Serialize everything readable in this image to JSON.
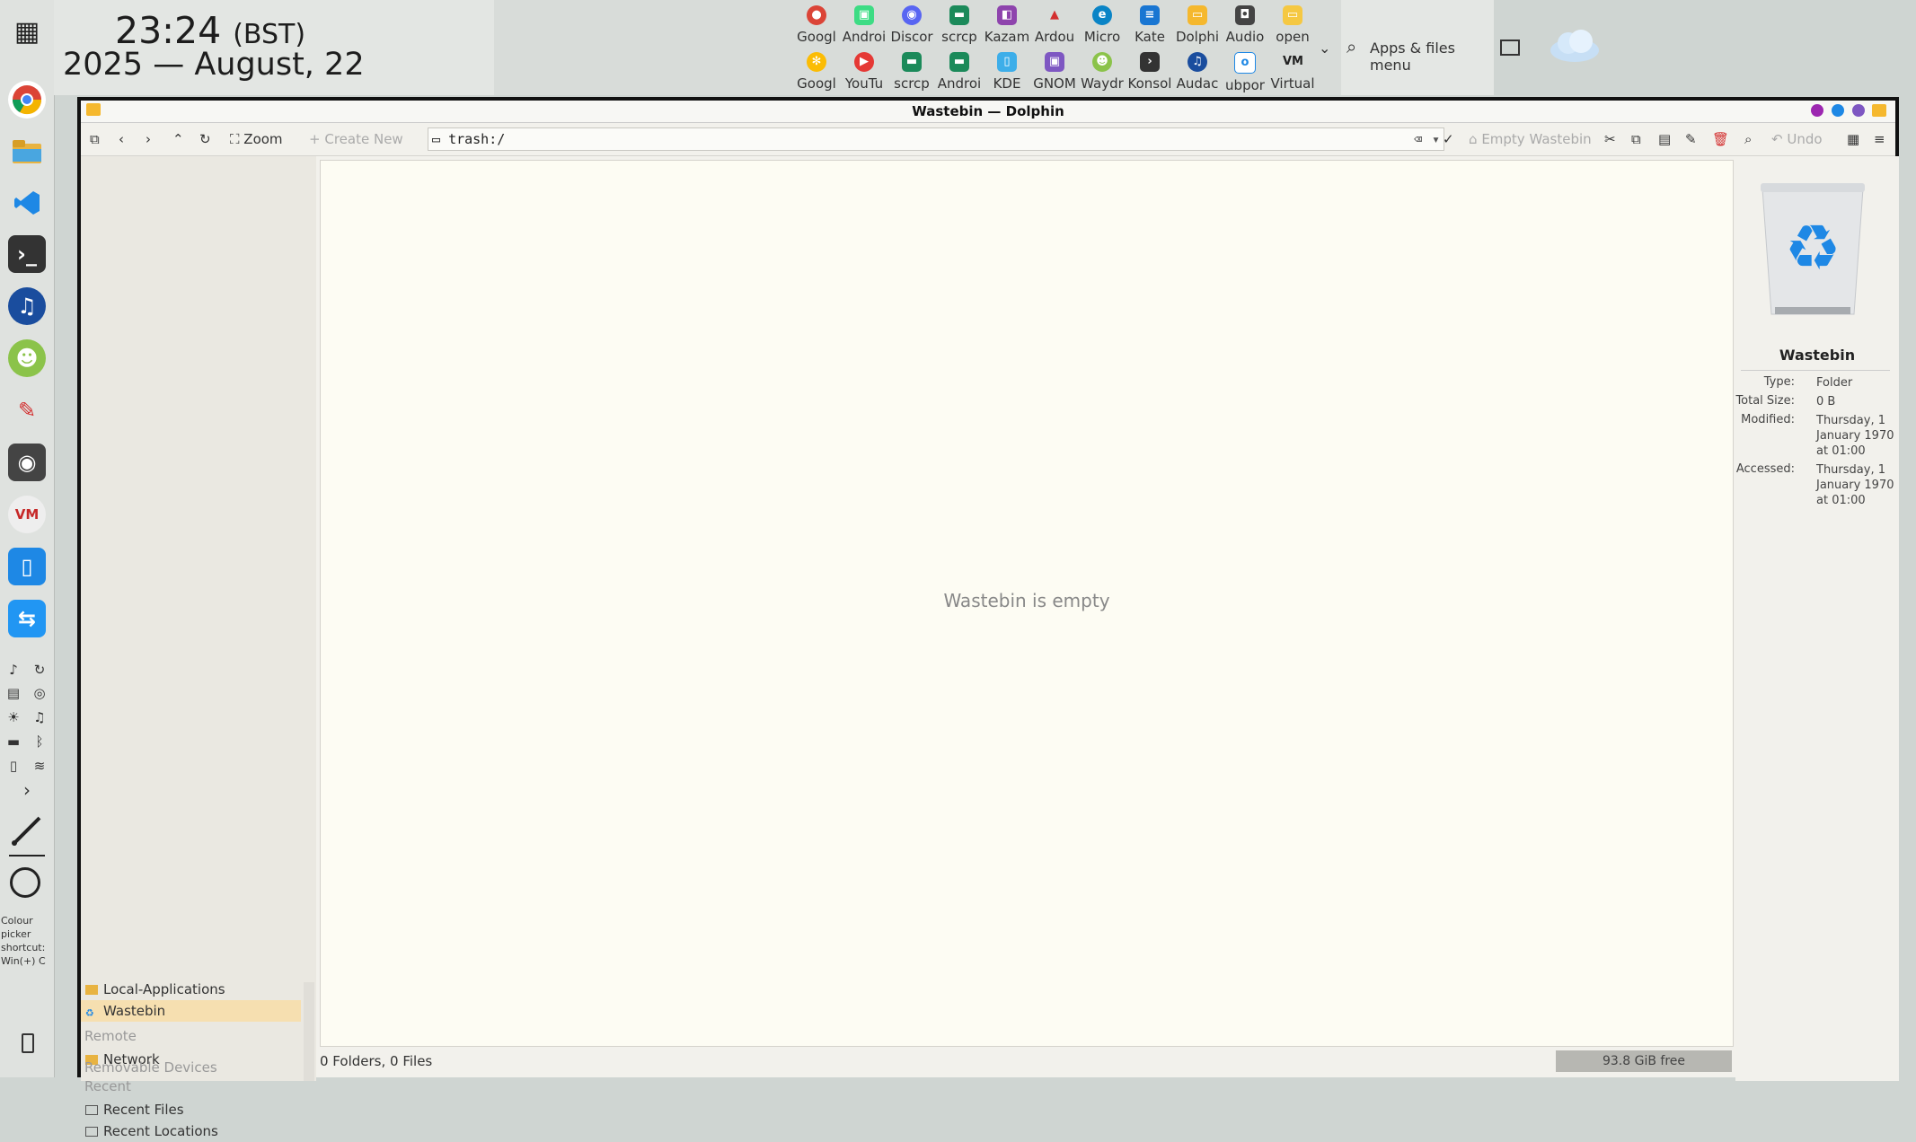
{
  "clock": {
    "time": "23:24",
    "tz": "(BST)",
    "date": "2025 — August, 22"
  },
  "launchers_row1": [
    "Googl",
    "Androi",
    "Discor",
    "scrcp",
    "Kazam",
    "Ardou",
    "Micro",
    "Kate",
    "Dolphi",
    "Audio",
    "open"
  ],
  "launchers_row2": [
    "Googl",
    "YouTu",
    "scrcp",
    "Androi",
    "KDE",
    "GNOM",
    "Waydr",
    "Konsol",
    "Audac",
    "ubpor",
    "Virtual"
  ],
  "apps_menu": {
    "label": "Apps & files menu"
  },
  "dock": {
    "colour_hint": "Colour picker shortcut: Win(+) C"
  },
  "window": {
    "title": "Wastebin — Dolphin",
    "toolbar": {
      "zoom": "Zoom",
      "create_new": "Create New",
      "address": "trash:/",
      "empty_wastebin": "Empty Wastebin",
      "undo": "Undo"
    },
    "sidebar": {
      "items": [
        {
          "label": "Local-Applications"
        },
        {
          "label": "Wastebin"
        }
      ],
      "remote_heading": "Remote",
      "network": "Network",
      "recent_heading": "Recent",
      "recent_files": "Recent Files",
      "recent_locations": "Recent Locations",
      "removable_heading": "Removable Devices"
    },
    "content": {
      "empty_message": "Wastebin is empty"
    },
    "status": {
      "summary": "0 Folders, 0 Files",
      "free": "93.8 GiB free"
    },
    "info": {
      "name": "Wastebin",
      "type_label": "Type:",
      "type_value": "Folder",
      "size_label": "Total Size:",
      "size_value": "0 B",
      "modified_label": "Modified:",
      "modified_value": "Thursday, 1 January 1970 at 01:00",
      "accessed_label": "Accessed:",
      "accessed_value": "Thursday, 1 January 1970 at 01:00"
    }
  },
  "colors": {
    "accent_selection": "#f6dfb0",
    "trash_blue": "#1e88e5"
  }
}
